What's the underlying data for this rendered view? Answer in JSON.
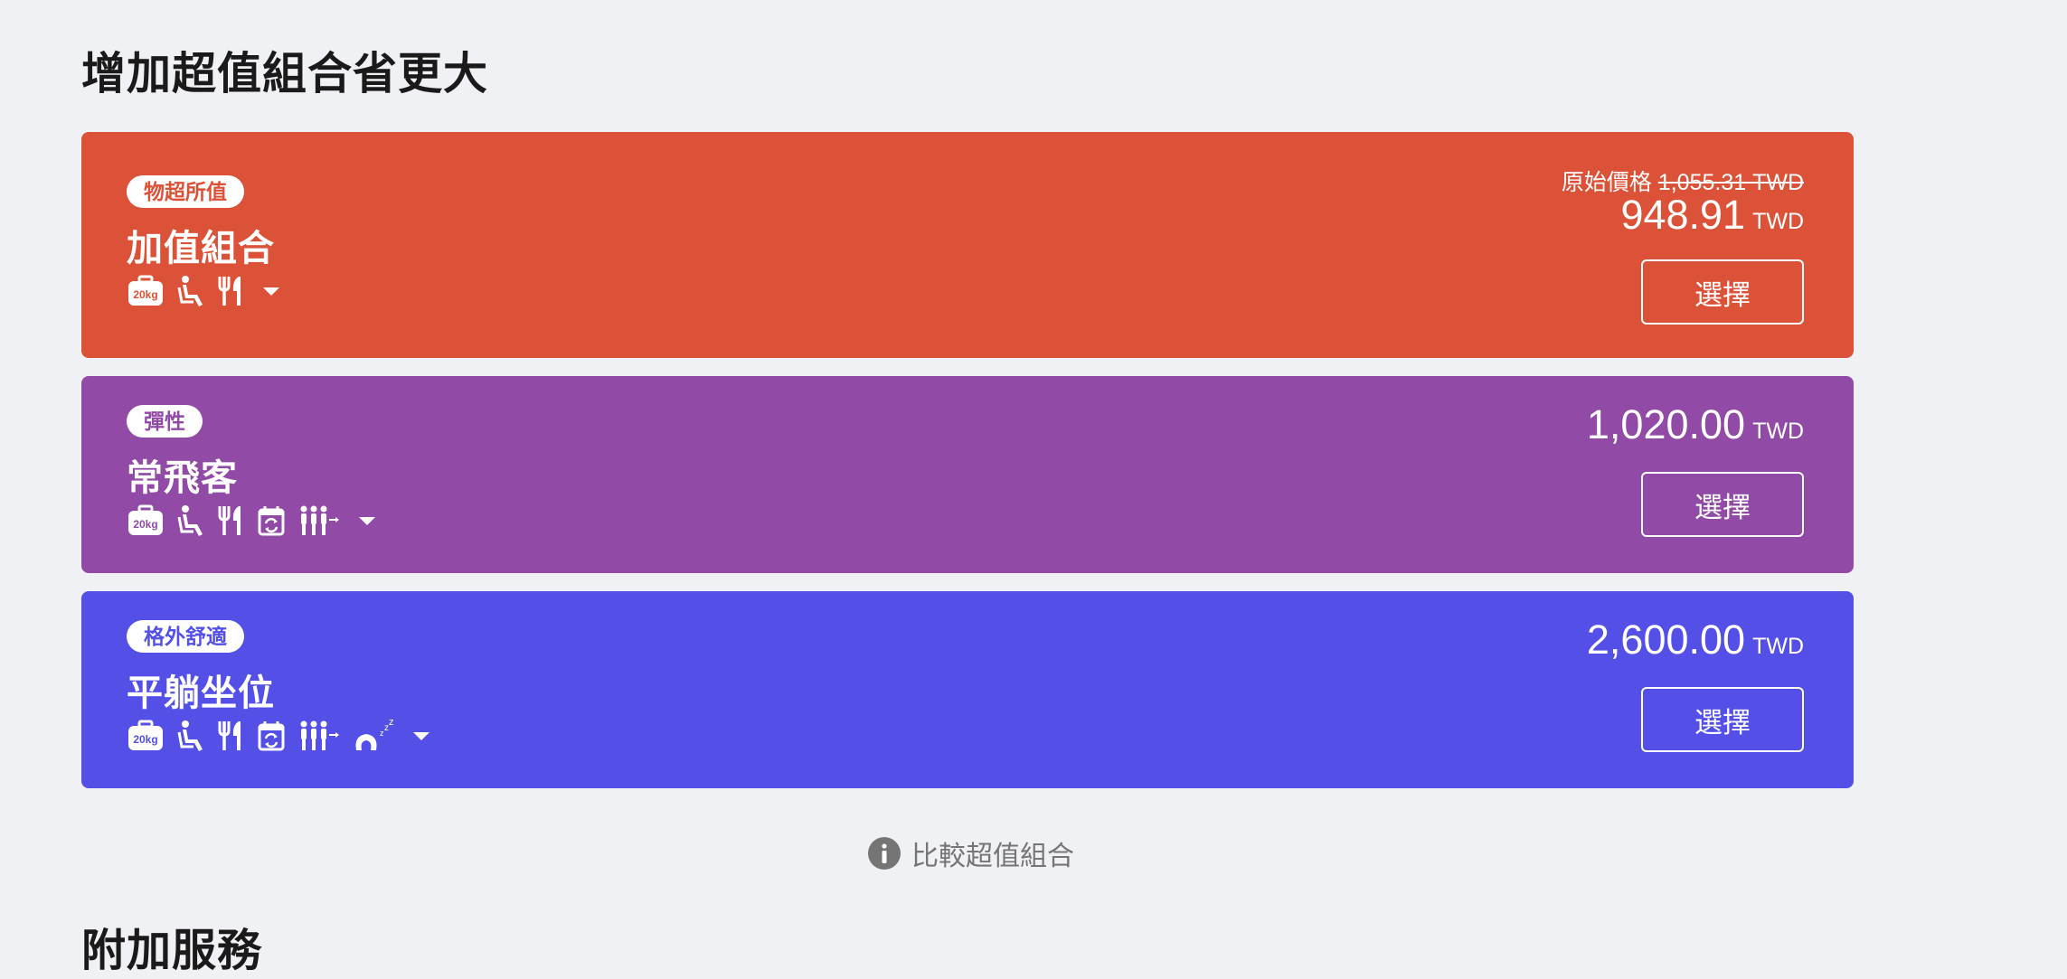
{
  "page_title": "增加超值組合省更大",
  "bundles": [
    {
      "tag": "物超所值",
      "name": "加值組合",
      "original_price_label": "原始價格",
      "original_price": "1,055.31 TWD",
      "price": "948.91",
      "currency": "TWD",
      "select_label": "選擇",
      "color": "#dc5238",
      "icons": [
        "baggage-20kg-icon",
        "seat-icon",
        "meal-icon"
      ]
    },
    {
      "tag": "彈性",
      "name": "常飛客",
      "price": "1,020.00",
      "currency": "TWD",
      "select_label": "選擇",
      "color": "#914ba6",
      "icons": [
        "baggage-20kg-icon",
        "seat-icon",
        "meal-icon",
        "flight-change-icon",
        "priority-boarding-icon"
      ]
    },
    {
      "tag": "格外舒適",
      "name": "平躺坐位",
      "price": "2,600.00",
      "currency": "TWD",
      "select_label": "選擇",
      "color": "#5450e7",
      "icons": [
        "baggage-20kg-icon",
        "seat-icon",
        "meal-icon",
        "flight-change-icon",
        "priority-boarding-icon",
        "comfort-kit-icon"
      ]
    }
  ],
  "baggage_label": "20kg",
  "compare_label": "比較超值組合",
  "next_section_title": "附加服務"
}
